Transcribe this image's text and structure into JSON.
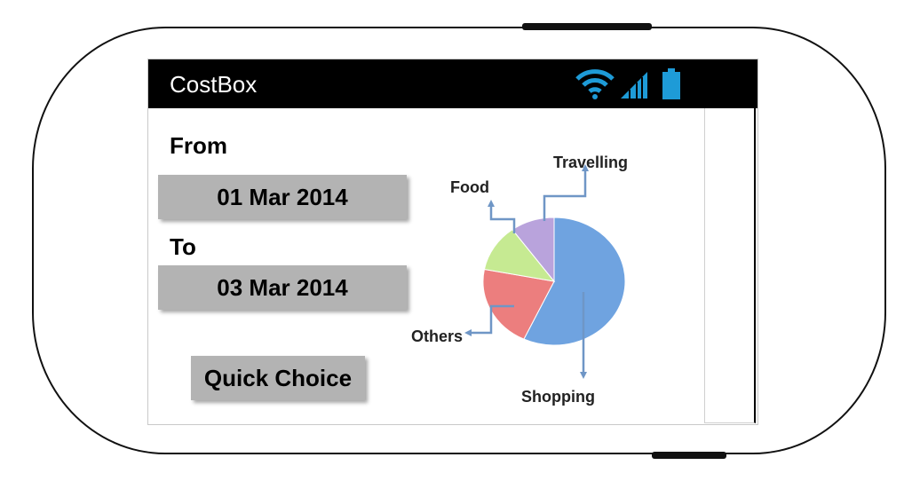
{
  "app": {
    "title": "CostBox"
  },
  "form": {
    "from_label": "From",
    "from_value": "01 Mar 2014",
    "to_label": "To",
    "to_value": "03 Mar 2014",
    "quick_choice_label": "Quick Choice"
  },
  "status_bar": {
    "icons": [
      "wifi-icon",
      "signal-icon",
      "battery-icon"
    ],
    "icon_color": "#1e9bd7"
  },
  "chart_data": {
    "type": "pie",
    "slices": [
      {
        "label": "Shopping",
        "value": 57,
        "color": "#6fa3e0"
      },
      {
        "label": "Others",
        "value": 21,
        "color": "#ec7e7e"
      },
      {
        "label": "Food",
        "value": 12,
        "color": "#c6ea92"
      },
      {
        "label": "Travelling",
        "value": 10,
        "color": "#b9a3dc"
      }
    ]
  }
}
